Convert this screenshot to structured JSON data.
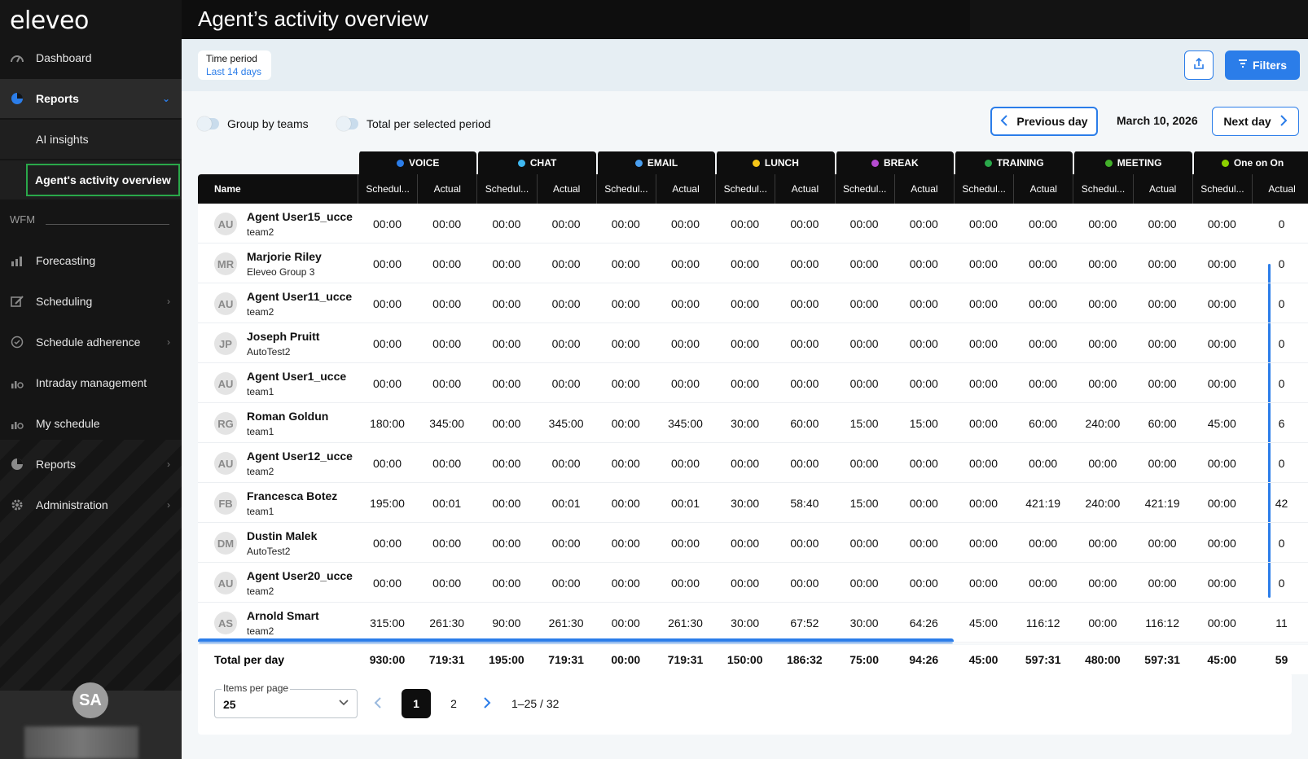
{
  "app": {
    "logo": "eleveo"
  },
  "sidebar": {
    "dashboard": "Dashboard",
    "reports_open": "Reports",
    "sub": [
      "AI insights",
      "Agent's activity overview"
    ],
    "section": "WFM",
    "items": [
      "Forecasting",
      "Scheduling",
      "Schedule adherence",
      "Intraday management",
      "My schedule",
      "Reports",
      "Administration"
    ],
    "user_initials": "SA"
  },
  "header": {
    "title": "Agent’s activity overview"
  },
  "toolbar": {
    "period_label": "Time period",
    "period_value": "Last 14 days",
    "filters_label": "Filters"
  },
  "controls": {
    "group_by_teams": "Group by teams",
    "total_per_period": "Total per selected period",
    "prev_day": "Previous day",
    "current_date": "March 10, 2026",
    "next_day": "Next day"
  },
  "table": {
    "name_header": "Name",
    "groups": [
      {
        "label": "VOICE",
        "color": "#2b7de9"
      },
      {
        "label": "CHAT",
        "color": "#3fb8f0"
      },
      {
        "label": "EMAIL",
        "color": "#4a9ff0"
      },
      {
        "label": "LUNCH",
        "color": "#f5c518"
      },
      {
        "label": "BREAK",
        "color": "#b54bd0"
      },
      {
        "label": "TRAINING",
        "color": "#2aa84a"
      },
      {
        "label": "MEETING",
        "color": "#43b02a"
      },
      {
        "label": "One on On",
        "color": "#8dd000"
      }
    ],
    "sub_headers": [
      "Schedul...",
      "Actual"
    ],
    "rows": [
      {
        "initials": "AU",
        "name": "Agent User15_ucce",
        "team": "team2",
        "values": [
          "00:00",
          "00:00",
          "00:00",
          "00:00",
          "00:00",
          "00:00",
          "00:00",
          "00:00",
          "00:00",
          "00:00",
          "00:00",
          "00:00",
          "00:00",
          "00:00",
          "00:00",
          "0"
        ]
      },
      {
        "initials": "MR",
        "name": "Marjorie Riley",
        "team": "Eleveo Group 3",
        "values": [
          "00:00",
          "00:00",
          "00:00",
          "00:00",
          "00:00",
          "00:00",
          "00:00",
          "00:00",
          "00:00",
          "00:00",
          "00:00",
          "00:00",
          "00:00",
          "00:00",
          "00:00",
          "0"
        ]
      },
      {
        "initials": "AU",
        "name": "Agent User11_ucce",
        "team": "team2",
        "values": [
          "00:00",
          "00:00",
          "00:00",
          "00:00",
          "00:00",
          "00:00",
          "00:00",
          "00:00",
          "00:00",
          "00:00",
          "00:00",
          "00:00",
          "00:00",
          "00:00",
          "00:00",
          "0"
        ]
      },
      {
        "initials": "JP",
        "name": "Joseph Pruitt",
        "team": "AutoTest2",
        "values": [
          "00:00",
          "00:00",
          "00:00",
          "00:00",
          "00:00",
          "00:00",
          "00:00",
          "00:00",
          "00:00",
          "00:00",
          "00:00",
          "00:00",
          "00:00",
          "00:00",
          "00:00",
          "0"
        ]
      },
      {
        "initials": "AU",
        "name": "Agent User1_ucce",
        "team": "team1",
        "values": [
          "00:00",
          "00:00",
          "00:00",
          "00:00",
          "00:00",
          "00:00",
          "00:00",
          "00:00",
          "00:00",
          "00:00",
          "00:00",
          "00:00",
          "00:00",
          "00:00",
          "00:00",
          "0"
        ]
      },
      {
        "initials": "RG",
        "name": "Roman Goldun",
        "team": "team1",
        "values": [
          "180:00",
          "345:00",
          "00:00",
          "345:00",
          "00:00",
          "345:00",
          "30:00",
          "60:00",
          "15:00",
          "15:00",
          "00:00",
          "60:00",
          "240:00",
          "60:00",
          "45:00",
          "6"
        ]
      },
      {
        "initials": "AU",
        "name": "Agent User12_ucce",
        "team": "team2",
        "values": [
          "00:00",
          "00:00",
          "00:00",
          "00:00",
          "00:00",
          "00:00",
          "00:00",
          "00:00",
          "00:00",
          "00:00",
          "00:00",
          "00:00",
          "00:00",
          "00:00",
          "00:00",
          "0"
        ]
      },
      {
        "initials": "FB",
        "name": "Francesca Botez",
        "team": "team1",
        "values": [
          "195:00",
          "00:01",
          "00:00",
          "00:01",
          "00:00",
          "00:01",
          "30:00",
          "58:40",
          "15:00",
          "00:00",
          "00:00",
          "421:19",
          "240:00",
          "421:19",
          "00:00",
          "42"
        ]
      },
      {
        "initials": "DM",
        "name": "Dustin Malek",
        "team": "AutoTest2",
        "values": [
          "00:00",
          "00:00",
          "00:00",
          "00:00",
          "00:00",
          "00:00",
          "00:00",
          "00:00",
          "00:00",
          "00:00",
          "00:00",
          "00:00",
          "00:00",
          "00:00",
          "00:00",
          "0"
        ]
      },
      {
        "initials": "AU",
        "name": "Agent User20_ucce",
        "team": "team2",
        "values": [
          "00:00",
          "00:00",
          "00:00",
          "00:00",
          "00:00",
          "00:00",
          "00:00",
          "00:00",
          "00:00",
          "00:00",
          "00:00",
          "00:00",
          "00:00",
          "00:00",
          "00:00",
          "0"
        ]
      },
      {
        "initials": "AS",
        "name": "Arnold Smart",
        "team": "team2",
        "values": [
          "315:00",
          "261:30",
          "90:00",
          "261:30",
          "00:00",
          "261:30",
          "30:00",
          "67:52",
          "30:00",
          "64:26",
          "45:00",
          "116:12",
          "00:00",
          "116:12",
          "00:00",
          "11"
        ]
      }
    ],
    "total_label": "Total per day",
    "totals": [
      "930:00",
      "719:31",
      "195:00",
      "719:31",
      "00:00",
      "719:31",
      "150:00",
      "186:32",
      "75:00",
      "94:26",
      "45:00",
      "597:31",
      "480:00",
      "597:31",
      "45:00",
      "59"
    ]
  },
  "pagination": {
    "items_per_page_label": "Items per page",
    "items_per_page_value": "25",
    "pages": [
      "1",
      "2"
    ],
    "range": "1–25 / 32"
  }
}
